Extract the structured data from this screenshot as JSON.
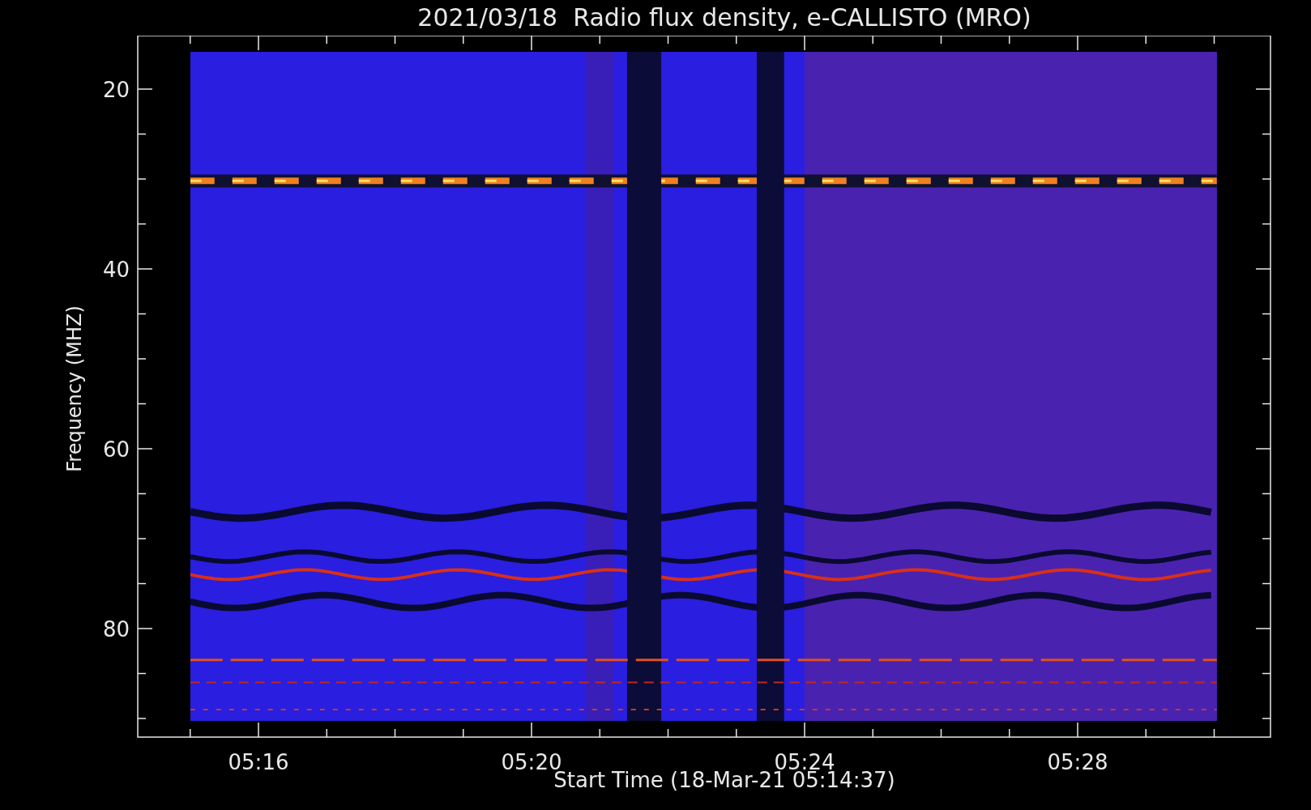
{
  "plot": {
    "title": "2021/03/18  Radio flux density, e-CALLISTO (MRO)",
    "y_axis": {
      "label": "Frequency (MHZ)",
      "tick_labels": [
        "20",
        "40",
        "60",
        "80"
      ]
    },
    "x_axis": {
      "label": "Start Time (18-Mar-21 05:14:37)",
      "tick_labels": [
        "05:16",
        "05:20",
        "05:24",
        "05:28"
      ]
    }
  }
}
